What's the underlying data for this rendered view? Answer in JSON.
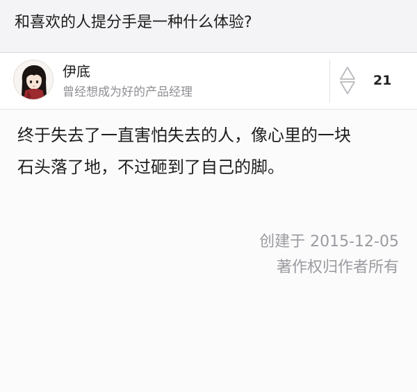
{
  "question": {
    "title": "和喜欢的人提分手是一种什么体验?"
  },
  "author": {
    "name": "伊底",
    "bio": "曾经想成为好的产品经理",
    "avatar": "avatar-illustrated-girl"
  },
  "vote": {
    "icon": "vote-up-down-icon",
    "count": "21"
  },
  "answer": {
    "lines": [
      "终于失去了一直害怕失去的人，像心里的一块",
      "石头落了地，不过砸到了自己的脚。"
    ]
  },
  "footer": {
    "created": "创建于 2015-12-05",
    "copyright": "著作权归作者所有"
  },
  "colors": {
    "header_bg": "#f4f4f6",
    "page_bg": "#fbfbfb",
    "muted_text": "#8e8e93",
    "meta_text": "#9a9aa0"
  }
}
